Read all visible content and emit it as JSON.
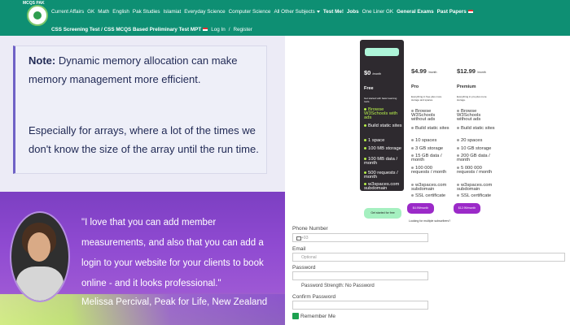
{
  "nav": {
    "logo_text": "MCQS PAK",
    "row1": [
      "Current Affairs",
      "GK",
      "Math",
      "English",
      "Pak Studies",
      "Islamiat",
      "Everyday Science",
      "Computer Science",
      "All Other Subjects"
    ],
    "row1_bold": [
      "Test Me!",
      "Jobs"
    ],
    "row1_more": [
      "One Liner GK"
    ],
    "row1_bold2": [
      "General Exams",
      "Past Papers"
    ],
    "row2": [
      "CSS Screening Test / CSS MCQS Based Preliminary Test MPT"
    ],
    "row2_links": [
      "Log In",
      "Register"
    ],
    "colors": {
      "nav_bg": "#0e8f73",
      "note_border": "#6f62c6"
    }
  },
  "note": {
    "label": "Note:",
    "text1": "Dynamic memory allocation can make memory management more efficient.",
    "text2": "Especially for arrays, where a lot of the times we don't know the size of the array until the run time."
  },
  "testimonial": {
    "quote": "\"I love that you can add member measurements, and also that you can add a login to your website for your clients to book online - and it looks professional.\"",
    "author": "Melissa Percival, Peak for Life, New Zealand"
  },
  "pricing": {
    "plans": [
      {
        "price": "$0",
        "per": "/month",
        "name": "Free",
        "desc": "Get started with basic learning tools.",
        "features": [
          "Browse W3Schools with ads",
          "Build static sites",
          "1 space",
          "100 MB storage",
          "100 MB data / month",
          "500 requests / month",
          "w3spaces.com subdomain"
        ],
        "button": "Get started for free"
      },
      {
        "price": "$4.99",
        "per": "/month",
        "name": "Pro",
        "desc": "Everything in free plus more storage and spaces.",
        "features": [
          "Browse W3Schools without ads",
          "Build static sites",
          "10 spaces",
          "3 GB storage",
          "15 GB data / month",
          "100 000 requests / month",
          "w3spaces.com subdomain",
          "SSL certificate"
        ],
        "button": "$4.99/month"
      },
      {
        "price": "$12.99",
        "per": "/month",
        "name": "Premium",
        "desc": "Everything in pro plus more storage.",
        "features": [
          "Browse W3Schools without ads",
          "Build static sites",
          "20 spaces",
          "10 GB storage",
          "200 GB data / month",
          "5 000 000 requests / month",
          "w3spaces.com subdomain",
          "SSL certificate"
        ],
        "button": "$12.99/month"
      }
    ],
    "note": "Looking for multiple subscribers?"
  },
  "form": {
    "phone_label": "Phone Number",
    "phone_value": "+93",
    "email_label": "Email",
    "email_placeholder": "Optional",
    "password_label": "Password",
    "strength_text": "Password Strength: No Password",
    "confirm_label": "Confirm Password",
    "remember_label": "Remember Me"
  }
}
